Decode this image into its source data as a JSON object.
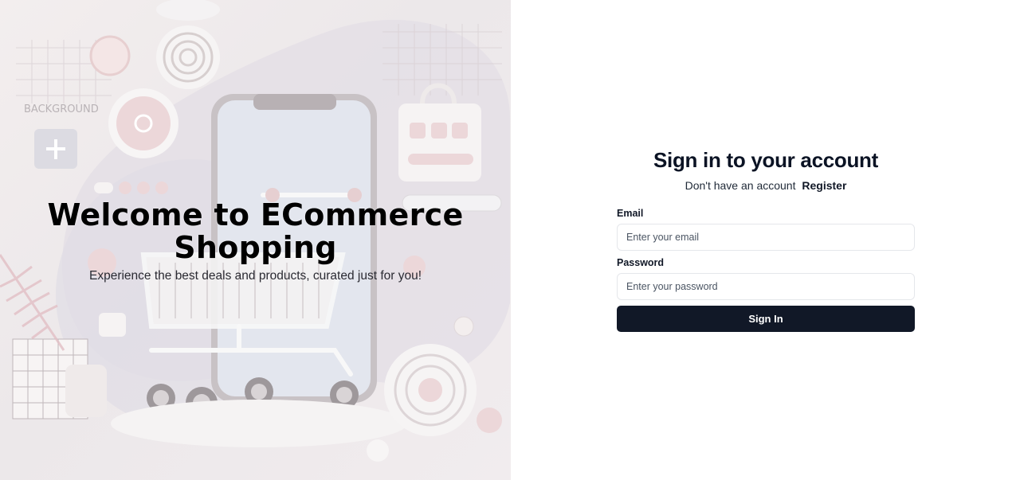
{
  "hero": {
    "title_line1": "Welcome to ECommerce",
    "title_line2": "Shopping",
    "subtitle": "Experience the best deals and products, curated just for you!",
    "background_image": {
      "icon": "shopping-cart-phone-illustration",
      "overlay_text": "BACKGROUND"
    }
  },
  "login": {
    "title": "Sign in to your account",
    "register_prompt": "Don't have an account",
    "register_link": "Register",
    "email_label": "Email",
    "email_placeholder": "Enter your email",
    "password_label": "Password",
    "password_placeholder": "Enter your password",
    "submit_label": "Sign In"
  },
  "colors": {
    "primary_button": "#111827",
    "hero_background": "#efeaec",
    "accent_pink": "#e8cfd2"
  }
}
